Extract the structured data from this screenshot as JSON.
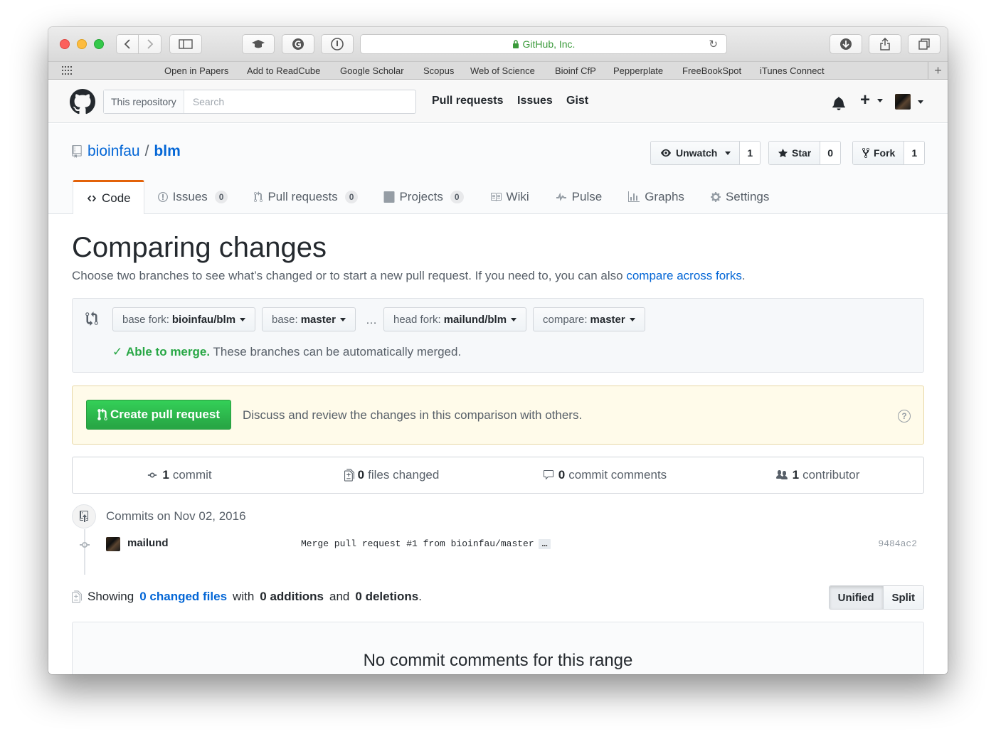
{
  "browser": {
    "url_display": "GitHub, Inc.",
    "bookmarks": [
      "Open in Papers",
      "Add to ReadCube",
      "Google Scholar",
      "Scopus",
      "Web of Science",
      "Bioinf CfP",
      "Pepperplate",
      "FreeBookSpot",
      "iTunes Connect"
    ]
  },
  "header": {
    "search_scope": "This repository",
    "search_placeholder": "Search",
    "nav": [
      "Pull requests",
      "Issues",
      "Gist"
    ]
  },
  "repo": {
    "owner": "bioinfau",
    "separator": "/",
    "name": "blm",
    "unwatch_label": "Unwatch",
    "watch_count": "1",
    "star_label": "Star",
    "star_count": "0",
    "fork_label": "Fork",
    "fork_count": "1",
    "tabs": [
      {
        "label": "Code",
        "counter": ""
      },
      {
        "label": "Issues",
        "counter": "0"
      },
      {
        "label": "Pull requests",
        "counter": "0"
      },
      {
        "label": "Projects",
        "counter": "0"
      },
      {
        "label": "Wiki",
        "counter": ""
      },
      {
        "label": "Pulse",
        "counter": ""
      },
      {
        "label": "Graphs",
        "counter": ""
      },
      {
        "label": "Settings",
        "counter": ""
      }
    ]
  },
  "compare": {
    "title": "Comparing changes",
    "subtitle": "Choose two branches to see what’s changed or to start a new pull request. If you need to, you can also",
    "subtitle_link": "compare across forks",
    "subtitle_end": ".",
    "base_fork_label": "base fork:",
    "base_fork_value": "bioinfau/blm",
    "base_label": "base:",
    "base_value": "master",
    "ellipsis": "…",
    "head_fork_label": "head fork:",
    "head_fork_value": "mailund/blm",
    "compare_label": "compare:",
    "compare_value": "master",
    "merge_ok": "Able to merge.",
    "merge_msg": "These branches can be automatically merged."
  },
  "pr_banner": {
    "button": "Create pull request",
    "description": "Discuss and review the changes in this comparison with others.",
    "help": "?"
  },
  "summary": {
    "commits_count": "1",
    "commits_label": "commit",
    "files_count": "0",
    "files_label": "files changed",
    "comments_count": "0",
    "comments_label": "commit comments",
    "contributors_count": "1",
    "contributors_label": "contributor"
  },
  "commits": {
    "heading": "Commits on Nov 02, 2016",
    "items": [
      {
        "author": "mailund",
        "message": "Merge pull request #1 from bioinfau/master",
        "expander": "…",
        "sha": "9484ac2"
      }
    ]
  },
  "toc": {
    "showing": "Showing",
    "changed_files": "0 changed files",
    "with": "with",
    "additions": "0 additions",
    "and": "and",
    "deletions": "0 deletions",
    "end": ".",
    "unified": "Unified",
    "split": "Split"
  },
  "blankslate": {
    "title": "No commit comments for this range"
  }
}
